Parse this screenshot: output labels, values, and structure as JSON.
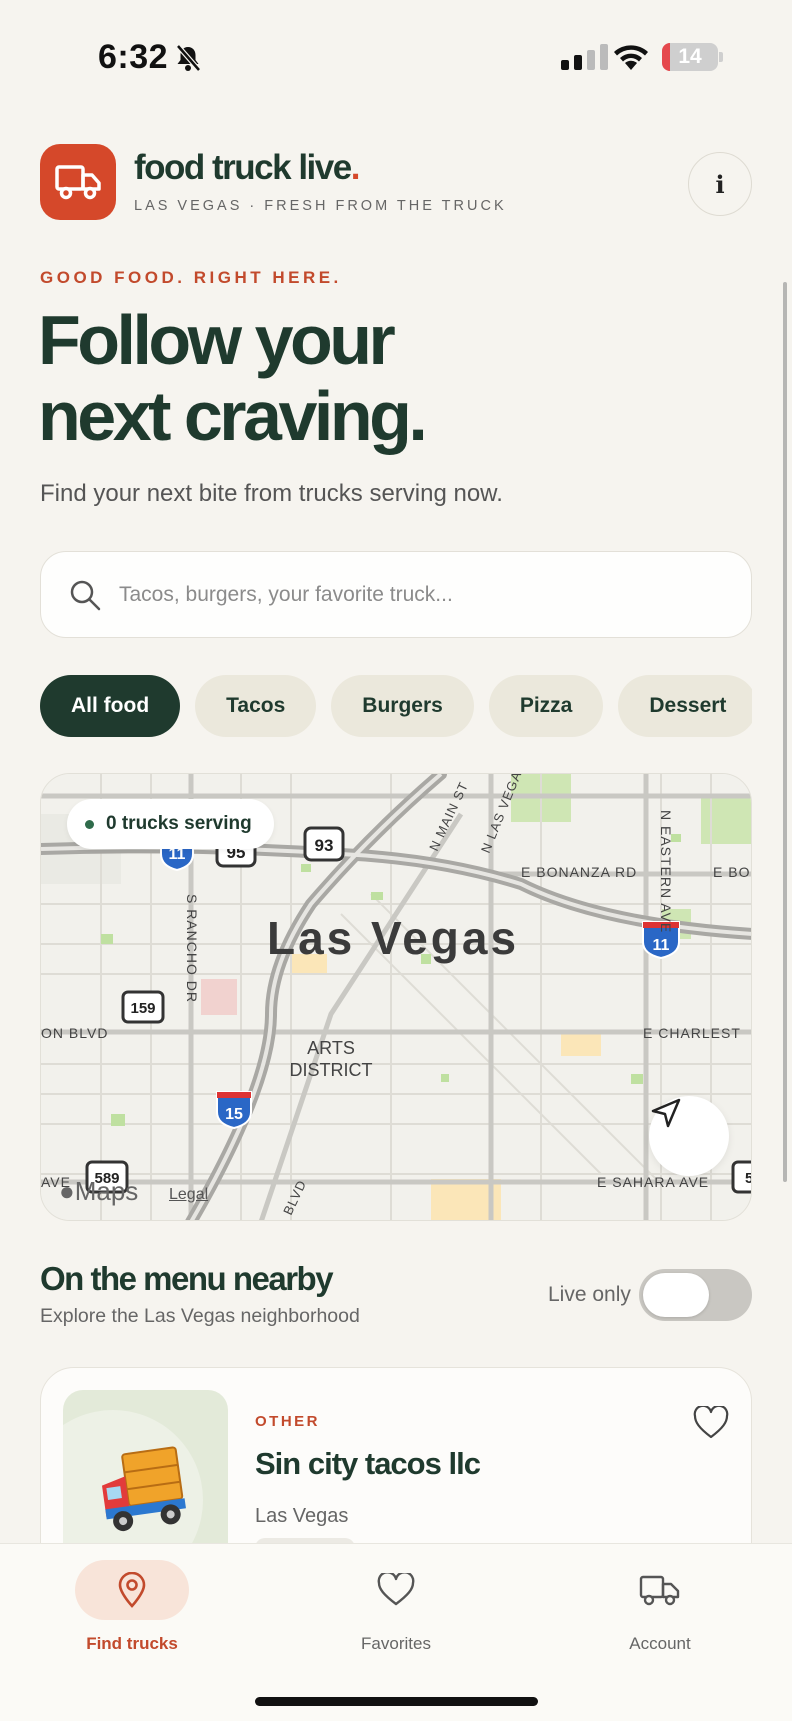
{
  "status_bar": {
    "time": "6:32",
    "battery": "14",
    "battery_level": 0.14
  },
  "header": {
    "brand": "food truck live",
    "brand_dot": ".",
    "tagline": "LAS VEGAS · FRESH FROM THE TRUCK",
    "info_label": "i"
  },
  "hero": {
    "eyebrow": "GOOD FOOD. RIGHT HERE.",
    "title_line1": "Follow your",
    "title_line2": "next craving.",
    "subtitle": "Find your next bite from trucks serving now."
  },
  "search": {
    "placeholder": "Tacos, burgers, your favorite truck..."
  },
  "filters": [
    {
      "label": "All food",
      "active": true
    },
    {
      "label": "Tacos",
      "active": false
    },
    {
      "label": "Burgers",
      "active": false
    },
    {
      "label": "Pizza",
      "active": false
    },
    {
      "label": "Dessert",
      "active": false
    }
  ],
  "map": {
    "serving_badge": "0 trucks serving",
    "city_label": "Las Vegas",
    "district_label_1": "ARTS",
    "district_label_2": "DISTRICT",
    "streets": {
      "bonanza": "E BONANZA RD",
      "bonanza_cut": "E BO",
      "charleston": "E CHARLEST",
      "charleston_w": "ON BLVD",
      "sahara": "E SAHARA AVE",
      "sahara_w": "AVE",
      "rancho": "S RANCHO DR",
      "eastern": "N EASTERN AVE",
      "main": "N MAIN ST",
      "lasvegas": "N LAS VEGA",
      "blvd": "BLVD"
    },
    "shields": {
      "i11a": "11",
      "us95": "95",
      "us93": "93",
      "i11b": "11",
      "sr159": "159",
      "i15": "15",
      "sr589": "589",
      "edge": "5"
    },
    "attribution": "Maps",
    "legal": "Legal"
  },
  "section": {
    "title": "On the menu nearby",
    "subtitle": "Explore the Las Vegas neighborhood",
    "live_label": "Live only",
    "live_only": false
  },
  "trucks": [
    {
      "category": "OTHER",
      "name": "Sin city tacos llc",
      "location": "Las Vegas",
      "emoji": "🚚"
    }
  ],
  "tabbar": {
    "tabs": [
      {
        "label": "Find trucks",
        "icon": "location-pin-icon",
        "active": true
      },
      {
        "label": "Favorites",
        "icon": "heart-icon",
        "active": false
      },
      {
        "label": "Account",
        "icon": "truck-icon",
        "active": false
      }
    ]
  },
  "colors": {
    "brand_green": "#1f3a2e",
    "accent_orange": "#d5482a",
    "background": "#f6f4ef"
  }
}
